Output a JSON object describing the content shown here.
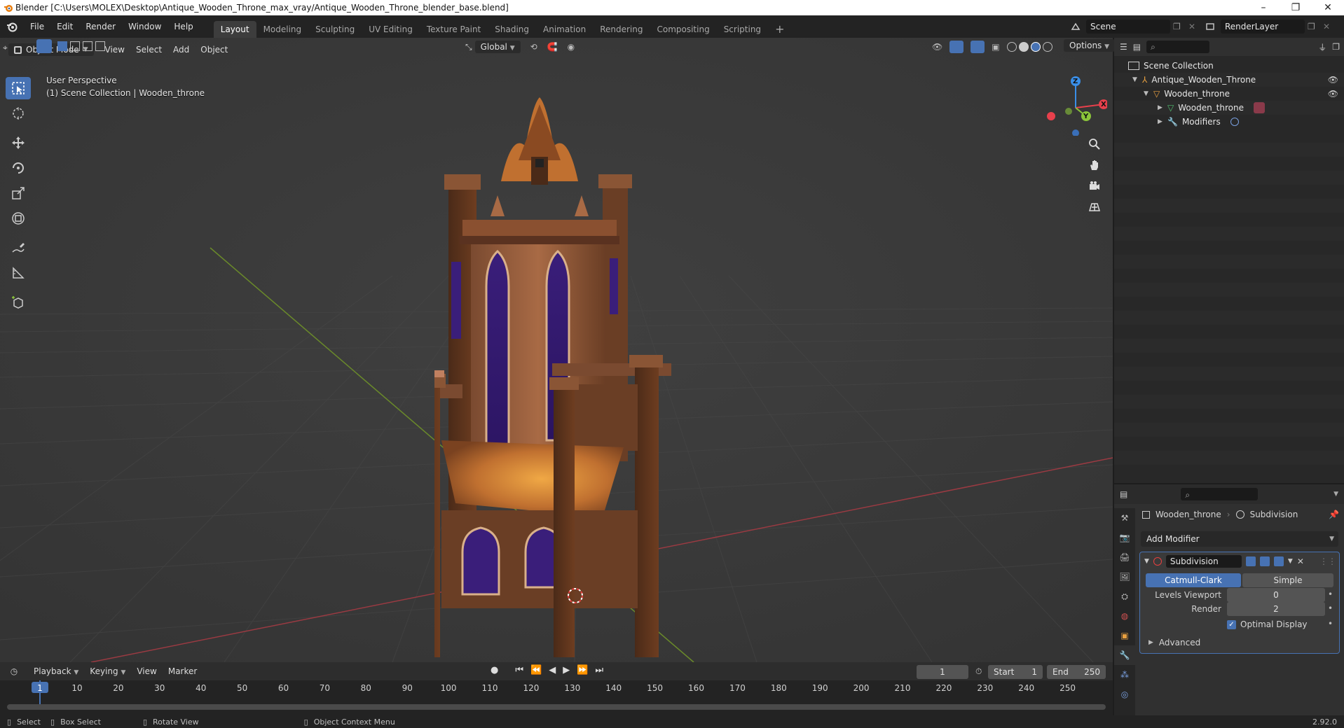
{
  "window": {
    "title": "Blender [C:\\Users\\MOLEX\\Desktop\\Antique_Wooden_Throne_max_vray/Antique_Wooden_Throne_blender_base.blend]",
    "minimize": "–",
    "restore": "❐",
    "close": "✕"
  },
  "menu": [
    "File",
    "Edit",
    "Render",
    "Window",
    "Help"
  ],
  "workspaces": [
    "Layout",
    "Modeling",
    "Sculpting",
    "UV Editing",
    "Texture Paint",
    "Shading",
    "Animation",
    "Rendering",
    "Compositing",
    "Scripting"
  ],
  "active_workspace": "Layout",
  "add_workspace": "+",
  "scene": {
    "name": "Scene",
    "render_layer": "RenderLayer"
  },
  "viewport": {
    "mode": "Object Mode",
    "menus": [
      "View",
      "Select",
      "Add",
      "Object"
    ],
    "transform_orientation": "Global",
    "options_label": "Options",
    "perspective": "User Perspective",
    "collection_info": "(1) Scene Collection | Wooden_throne",
    "gizmo": {
      "x": "X",
      "y": "Y",
      "z": "Z"
    },
    "tools": [
      "select-box-icon",
      "cursor-icon",
      "move-icon",
      "rotate-icon",
      "scale-icon",
      "transform-icon",
      "annotate-icon",
      "measure-icon",
      "add-cube-icon"
    ],
    "nav_tools": [
      "zoom-icon",
      "pan-hand-icon",
      "camera-icon",
      "ortho-grid-icon"
    ]
  },
  "outliner": {
    "search_placeholder": "",
    "items": [
      {
        "label": "Scene Collection",
        "depth": 0
      },
      {
        "label": "Antique_Wooden_Throne",
        "depth": 1
      },
      {
        "label": "Wooden_throne",
        "depth": 2
      },
      {
        "label": "Wooden_throne",
        "depth": 3
      },
      {
        "label": "Modifiers",
        "depth": 3
      }
    ]
  },
  "properties": {
    "object_name": "Wooden_throne",
    "modifier_context": "Subdivision",
    "add_modifier": "Add Modifier",
    "modifier": {
      "name": "Subdivision",
      "type_options": [
        "Catmull-Clark",
        "Simple"
      ],
      "selected_type": "Catmull-Clark",
      "levels_viewport_label": "Levels Viewport",
      "levels_viewport": "0",
      "render_label": "Render",
      "render": "2",
      "optimal_display_label": "Optimal Display",
      "optimal_display": true,
      "advanced_label": "Advanced"
    }
  },
  "timeline": {
    "menus": [
      "Playback",
      "Keying",
      "View",
      "Marker"
    ],
    "current_frame": "1",
    "start_label": "Start",
    "start": "1",
    "end_label": "End",
    "end": "250",
    "ticks": [
      "1",
      "10",
      "20",
      "30",
      "40",
      "50",
      "60",
      "70",
      "80",
      "90",
      "100",
      "110",
      "120",
      "130",
      "140",
      "150",
      "160",
      "170",
      "180",
      "190",
      "200",
      "210",
      "220",
      "230",
      "240",
      "250"
    ]
  },
  "statusbar": {
    "select": "Select",
    "box_select": "Box Select",
    "rotate_view": "Rotate View",
    "context_menu": "Object Context Menu",
    "version": "2.92.0"
  },
  "colors": {
    "accent": "#4772b3",
    "axis_x": "#e8404c",
    "axis_y": "#8bc43a",
    "axis_z": "#3a8fe8"
  }
}
